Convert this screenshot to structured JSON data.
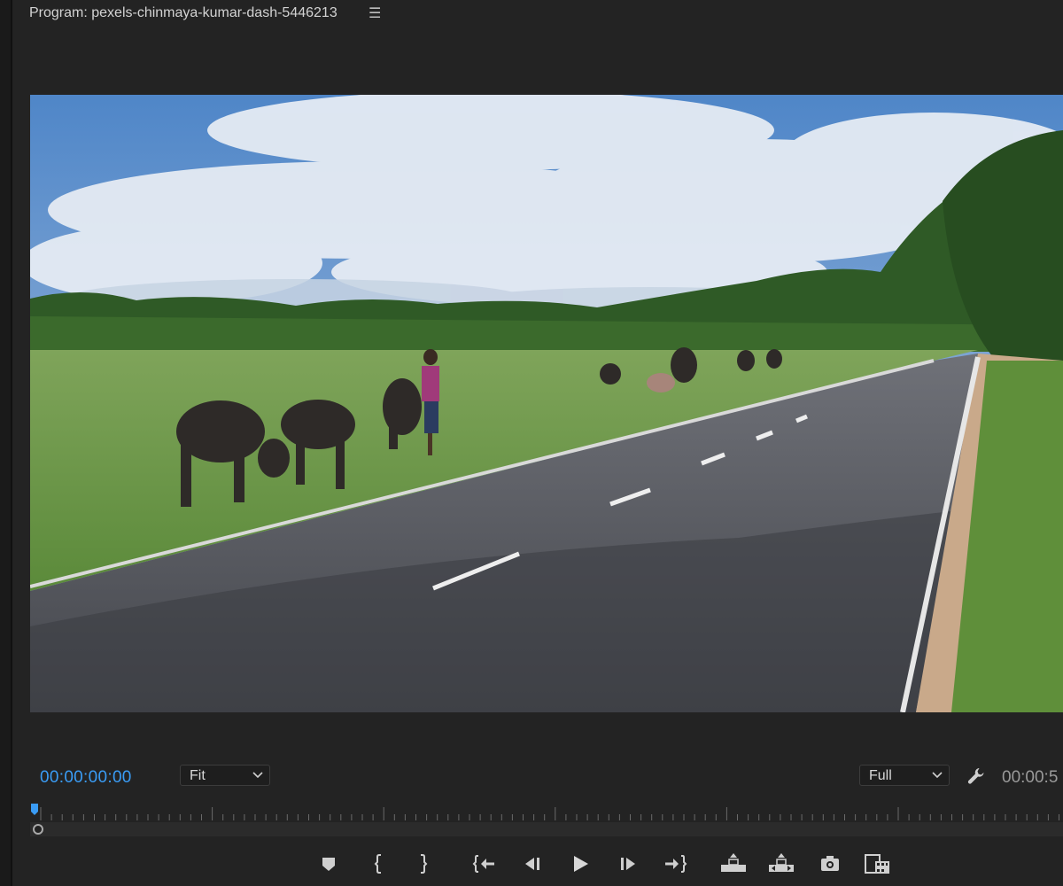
{
  "panel": {
    "title": "Program: pexels-chinmaya-kumar-dash-5446213",
    "menu_icon": "hamburger-menu-icon"
  },
  "controls": {
    "current_timecode": "00:00:00:00",
    "zoom_select": {
      "value": "Fit"
    },
    "resolution_select": {
      "value": "Full"
    },
    "settings_icon": "wrench-icon",
    "duration_timecode": "00:00:5"
  },
  "playhead": {
    "position": 0
  },
  "transport_buttons": [
    "add-marker-icon",
    "mark-in-icon",
    "mark-out-icon",
    "go-to-in-icon",
    "step-back-icon",
    "play-icon",
    "step-forward-icon",
    "go-to-out-icon",
    "lift-icon",
    "extract-icon",
    "export-frame-icon",
    "button-editor-icon"
  ],
  "colors": {
    "accent_blue": "#3a9cf5",
    "panel_bg": "#232323"
  }
}
